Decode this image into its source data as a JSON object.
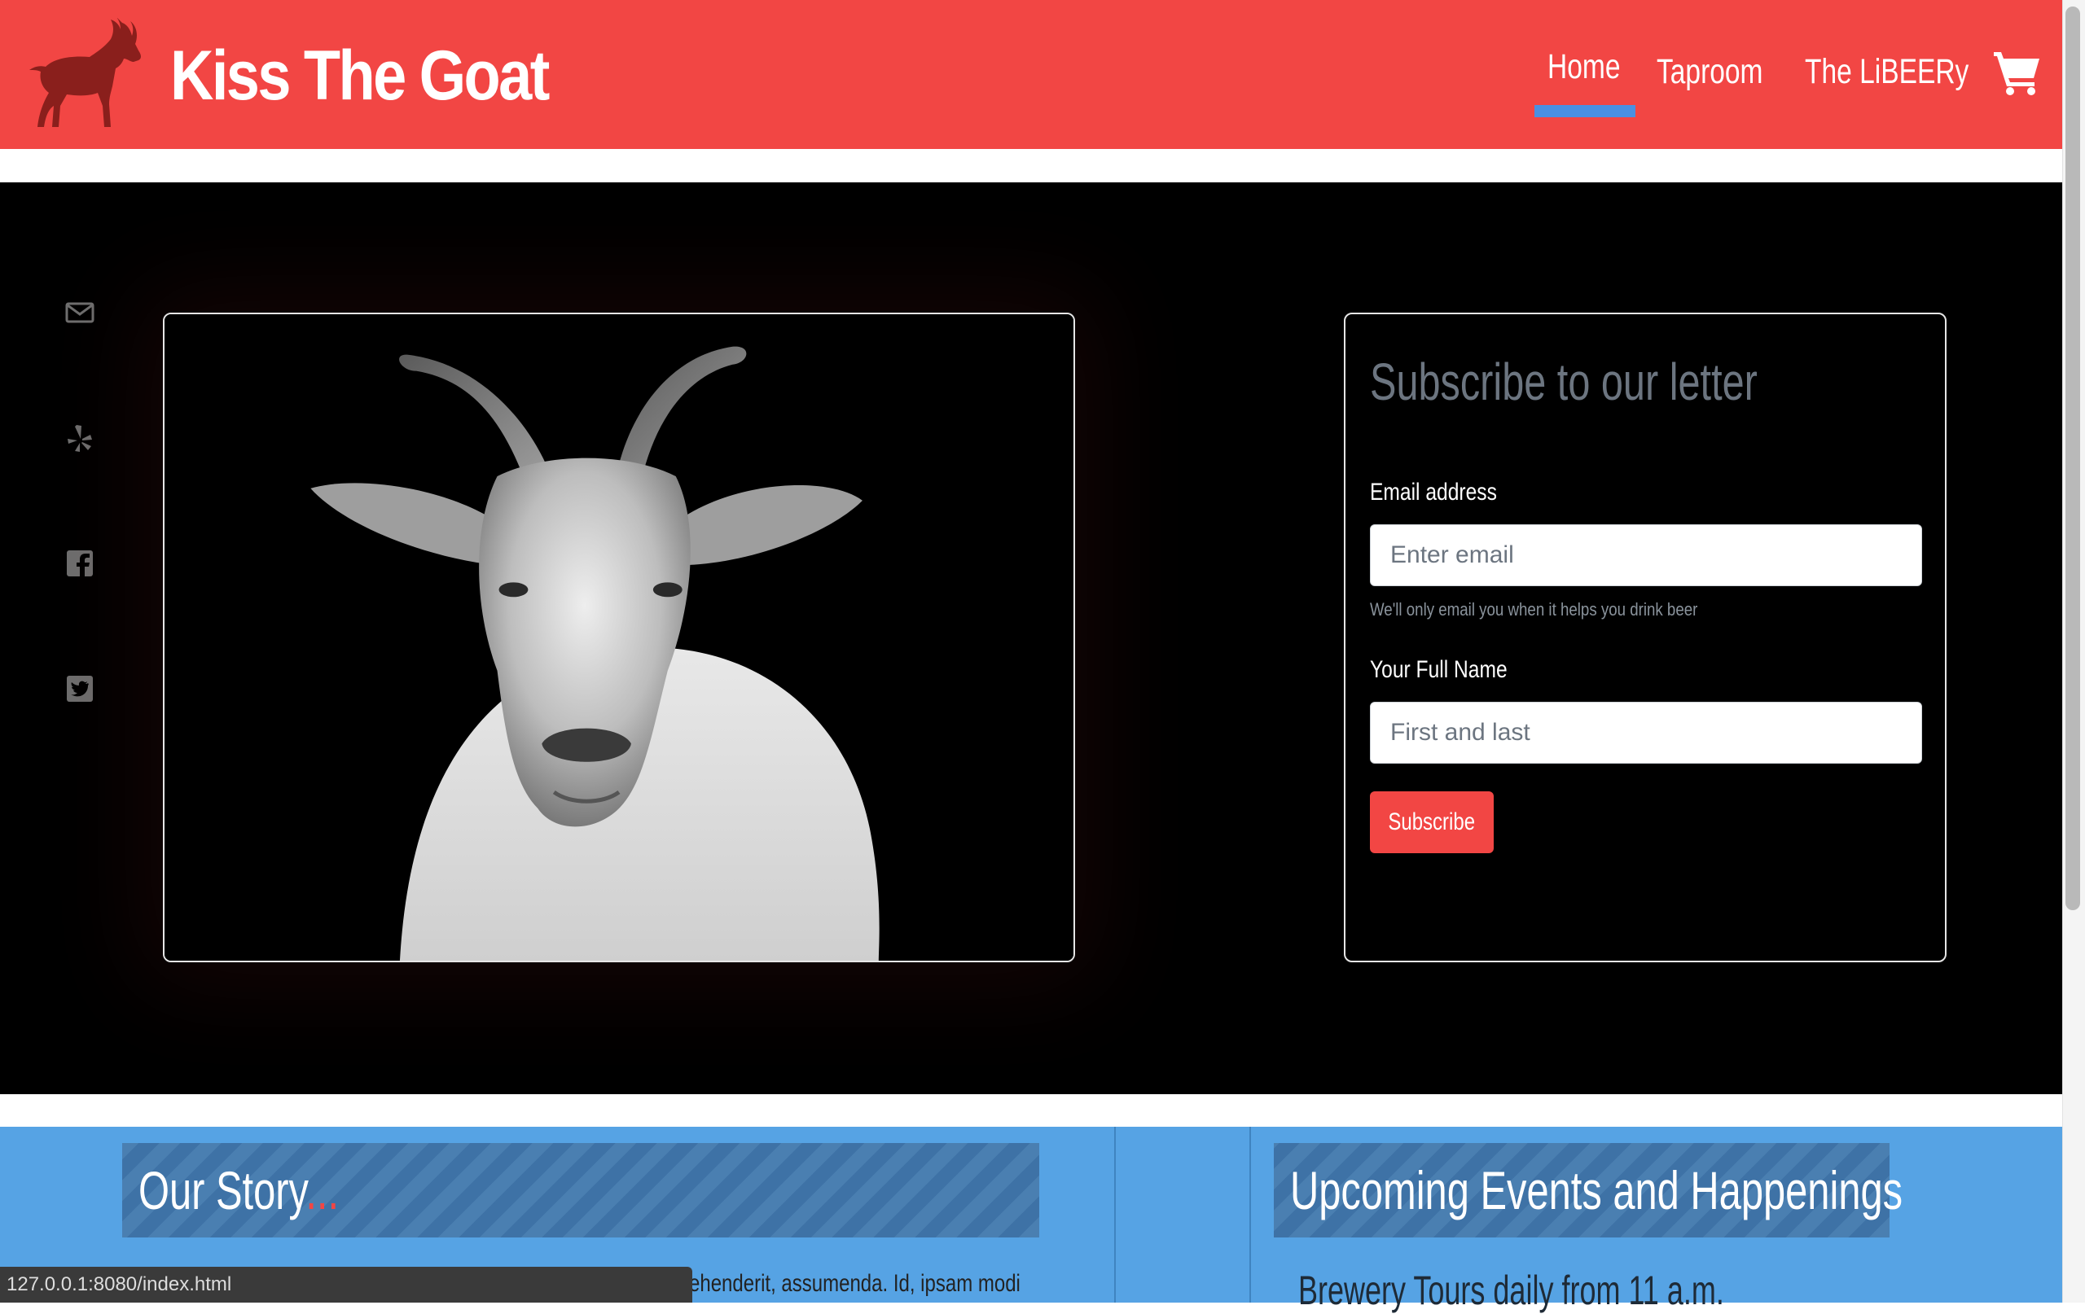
{
  "header": {
    "brand_name": "Kiss The Goat",
    "logo_icon": "goat-logo-icon",
    "nav": [
      {
        "label": "Home",
        "active": true
      },
      {
        "label": "Taproom",
        "active": false
      },
      {
        "label": "The LiBEERy",
        "active": false
      }
    ],
    "cart_icon": "shopping-cart-icon"
  },
  "hero": {
    "social_icons": [
      "envelope-icon",
      "yelp-icon",
      "facebook-icon",
      "twitter-icon"
    ],
    "subscribe": {
      "title": "Subscribe to our letter",
      "email_label": "Email address",
      "email_placeholder": "Enter email",
      "email_help": "We'll only email you when it helps you drink beer",
      "name_label": "Your Full Name",
      "name_placeholder": "First and last",
      "button_label": "Subscribe"
    }
  },
  "lower": {
    "story_heading": "Our Story",
    "story_ellipsis": "...",
    "story_text_visible": "ehenderit, assumenda. Id, ipsam modi",
    "events_heading": "Upcoming Events and Happenings",
    "event_first": "Brewery Tours daily from 11 a.m."
  },
  "browser": {
    "status_url": "127.0.0.1:8080/index.html"
  },
  "colors": {
    "brand_red": "#f24644",
    "accent_blue": "#4a90e2",
    "section_blue": "#56a3e4",
    "hero_bg": "#000000"
  }
}
